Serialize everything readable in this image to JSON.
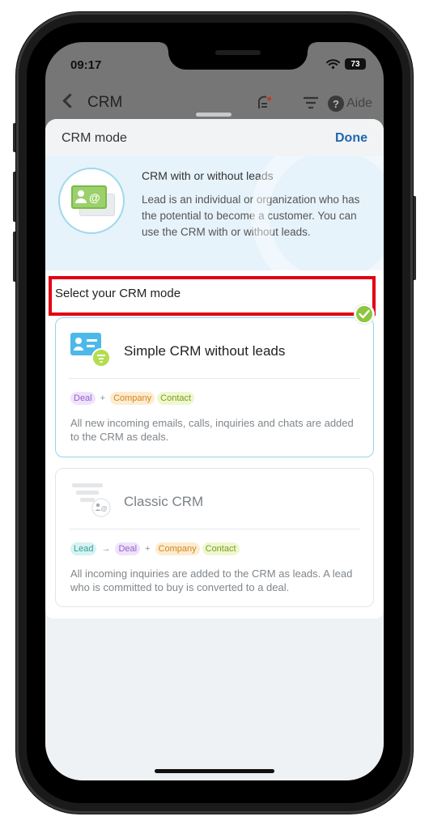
{
  "status_bar": {
    "time": "09:17",
    "battery": "73"
  },
  "background_app": {
    "title": "CRM",
    "help_label": "Aide",
    "help_glyph": "?"
  },
  "sheet": {
    "title": "CRM mode",
    "done_label": "Done",
    "info": {
      "title": "CRM with or without leads",
      "description": "Lead is an individual or organization who has the potential to become a customer. You can use the CRM with or without leads."
    },
    "section_title": "Select your CRM mode",
    "modes": [
      {
        "name": "Simple CRM without leads",
        "selected": true,
        "tags": [
          "Deal",
          "+",
          "Company",
          "Contact"
        ],
        "description": "All new incoming emails, calls, inquiries and chats are added to the CRM as deals."
      },
      {
        "name": "Classic CRM",
        "selected": false,
        "tags": [
          "Lead",
          "→",
          "Deal",
          "+",
          "Company",
          "Contact"
        ],
        "description": "All incoming inquiries are added to the CRM as leads. A lead who is committed to buy is converted to a deal."
      }
    ]
  },
  "colors": {
    "accent_blue": "#2067b0",
    "selected_border": "#95d3ec",
    "check_green": "#8cc63f",
    "highlight_red": "#e20012"
  },
  "icons": [
    "back-chevron-icon",
    "activity-stream-icon",
    "filter-icon",
    "help-icon",
    "wifi-icon",
    "battery-icon",
    "lead-contact-card-icon",
    "simple-crm-icon",
    "classic-crm-funnel-icon",
    "checkmark-icon"
  ]
}
